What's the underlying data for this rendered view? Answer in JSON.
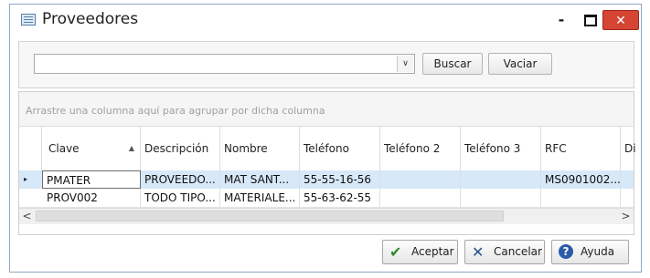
{
  "window": {
    "title": "Proveedores",
    "minimize": "-",
    "close": "✕"
  },
  "search": {
    "value": "",
    "dropdown_arrow": "∨",
    "buscar_label": "Buscar",
    "vaciar_label": "Vaciar"
  },
  "grid": {
    "group_panel_text": "Arrastre una columna aquí para agrupar por dicha columna",
    "columns": [
      "Clave",
      "Descripción",
      "Nombre",
      "Teléfono",
      "Teléfono 2",
      "Teléfono 3",
      "RFC",
      "Dire"
    ],
    "sort_column": "Clave",
    "sort_direction": "ascending",
    "rows": [
      [
        "PMATER",
        "PROVEEDO...",
        "MAT SANT...",
        "55-55-16-56",
        "",
        "",
        "MS0901002...",
        ""
      ],
      [
        "PROV002",
        "TODO TIPO...",
        "MATERIALE...",
        "55-63-62-55",
        "",
        "",
        "",
        ""
      ]
    ],
    "selected_row": 0,
    "row_indicator": "▸",
    "scroll_left": "<",
    "scroll_right": ">"
  },
  "footer": {
    "aceptar_label": "Aceptar",
    "cancelar_label": "Cancelar",
    "ayuda_label": "Ayuda"
  },
  "colors": {
    "selected_row": "#d7e8f8",
    "close_button": "#d64434",
    "help_icon": "#2b5aa8",
    "check_icon": "#2e8b2e"
  },
  "icons": {
    "app": "window-icon",
    "check": "check-icon",
    "cancel": "x-icon",
    "help": "help-icon"
  }
}
